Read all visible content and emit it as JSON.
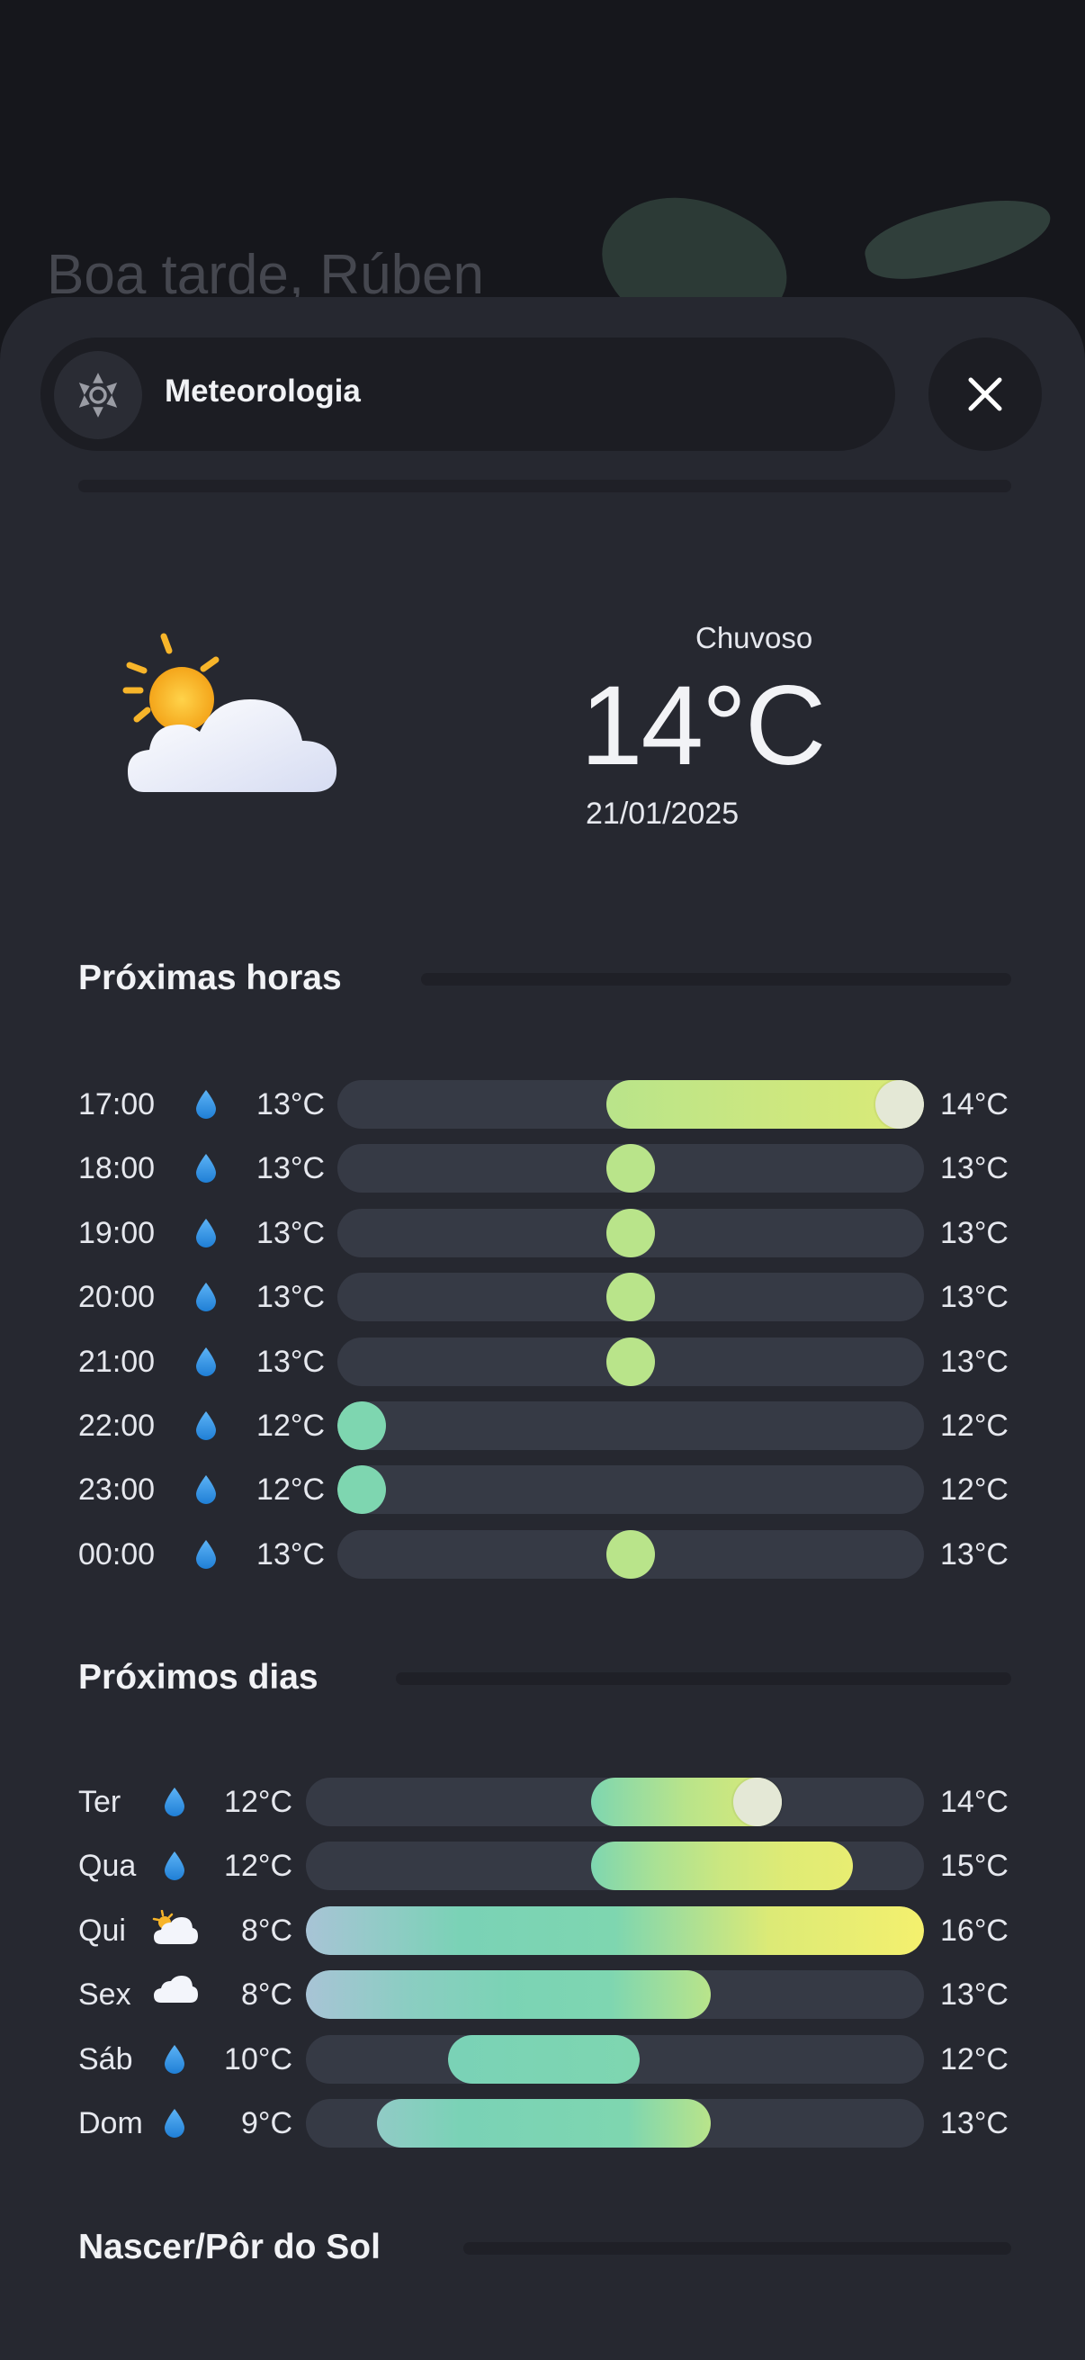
{
  "background": {
    "greeting": "Boa tarde, Rúben"
  },
  "header": {
    "title": "Meteorologia",
    "icon": "sun-gear-icon",
    "close_icon": "close-icon"
  },
  "current": {
    "condition": "Chuvoso",
    "temperature": "14°C",
    "date": "21/01/2025",
    "icon": "partly-cloudy-icon"
  },
  "hourly": {
    "title": "Próximas horas",
    "scale_min": 12,
    "scale_max": 14,
    "rows": [
      {
        "time": "17:00",
        "icon": "rain-drop-icon",
        "min": "13°C",
        "max": "14°C",
        "lo": 13,
        "hi": 14,
        "current": true
      },
      {
        "time": "18:00",
        "icon": "rain-drop-icon",
        "min": "13°C",
        "max": "13°C",
        "lo": 13,
        "hi": 13
      },
      {
        "time": "19:00",
        "icon": "rain-drop-icon",
        "min": "13°C",
        "max": "13°C",
        "lo": 13,
        "hi": 13
      },
      {
        "time": "20:00",
        "icon": "rain-drop-icon",
        "min": "13°C",
        "max": "13°C",
        "lo": 13,
        "hi": 13
      },
      {
        "time": "21:00",
        "icon": "rain-drop-icon",
        "min": "13°C",
        "max": "13°C",
        "lo": 13,
        "hi": 13
      },
      {
        "time": "22:00",
        "icon": "rain-drop-icon",
        "min": "12°C",
        "max": "12°C",
        "lo": 12,
        "hi": 12
      },
      {
        "time": "23:00",
        "icon": "rain-drop-icon",
        "min": "12°C",
        "max": "12°C",
        "lo": 12,
        "hi": 12
      },
      {
        "time": "00:00",
        "icon": "rain-drop-icon",
        "min": "13°C",
        "max": "13°C",
        "lo": 13,
        "hi": 13
      }
    ]
  },
  "daily": {
    "title": "Próximos dias",
    "scale_min": 8,
    "scale_max": 16,
    "rows": [
      {
        "day": "Ter",
        "icon": "rain-drop-icon",
        "min": "12°C",
        "max": "14°C",
        "lo": 12,
        "hi": 14,
        "current_value": 14
      },
      {
        "day": "Qua",
        "icon": "rain-drop-icon",
        "min": "12°C",
        "max": "15°C",
        "lo": 12,
        "hi": 15
      },
      {
        "day": "Qui",
        "icon": "sun-cloud-icon",
        "min": "8°C",
        "max": "16°C",
        "lo": 8,
        "hi": 16
      },
      {
        "day": "Sex",
        "icon": "cloud-icon",
        "min": "8°C",
        "max": "13°C",
        "lo": 8,
        "hi": 13
      },
      {
        "day": "Sáb",
        "icon": "rain-drop-icon",
        "min": "10°C",
        "max": "12°C",
        "lo": 10,
        "hi": 12
      },
      {
        "day": "Dom",
        "icon": "rain-drop-icon",
        "min": "9°C",
        "max": "13°C",
        "lo": 9,
        "hi": 13
      }
    ]
  },
  "sun": {
    "title": "Nascer/Pôr do Sol"
  }
}
